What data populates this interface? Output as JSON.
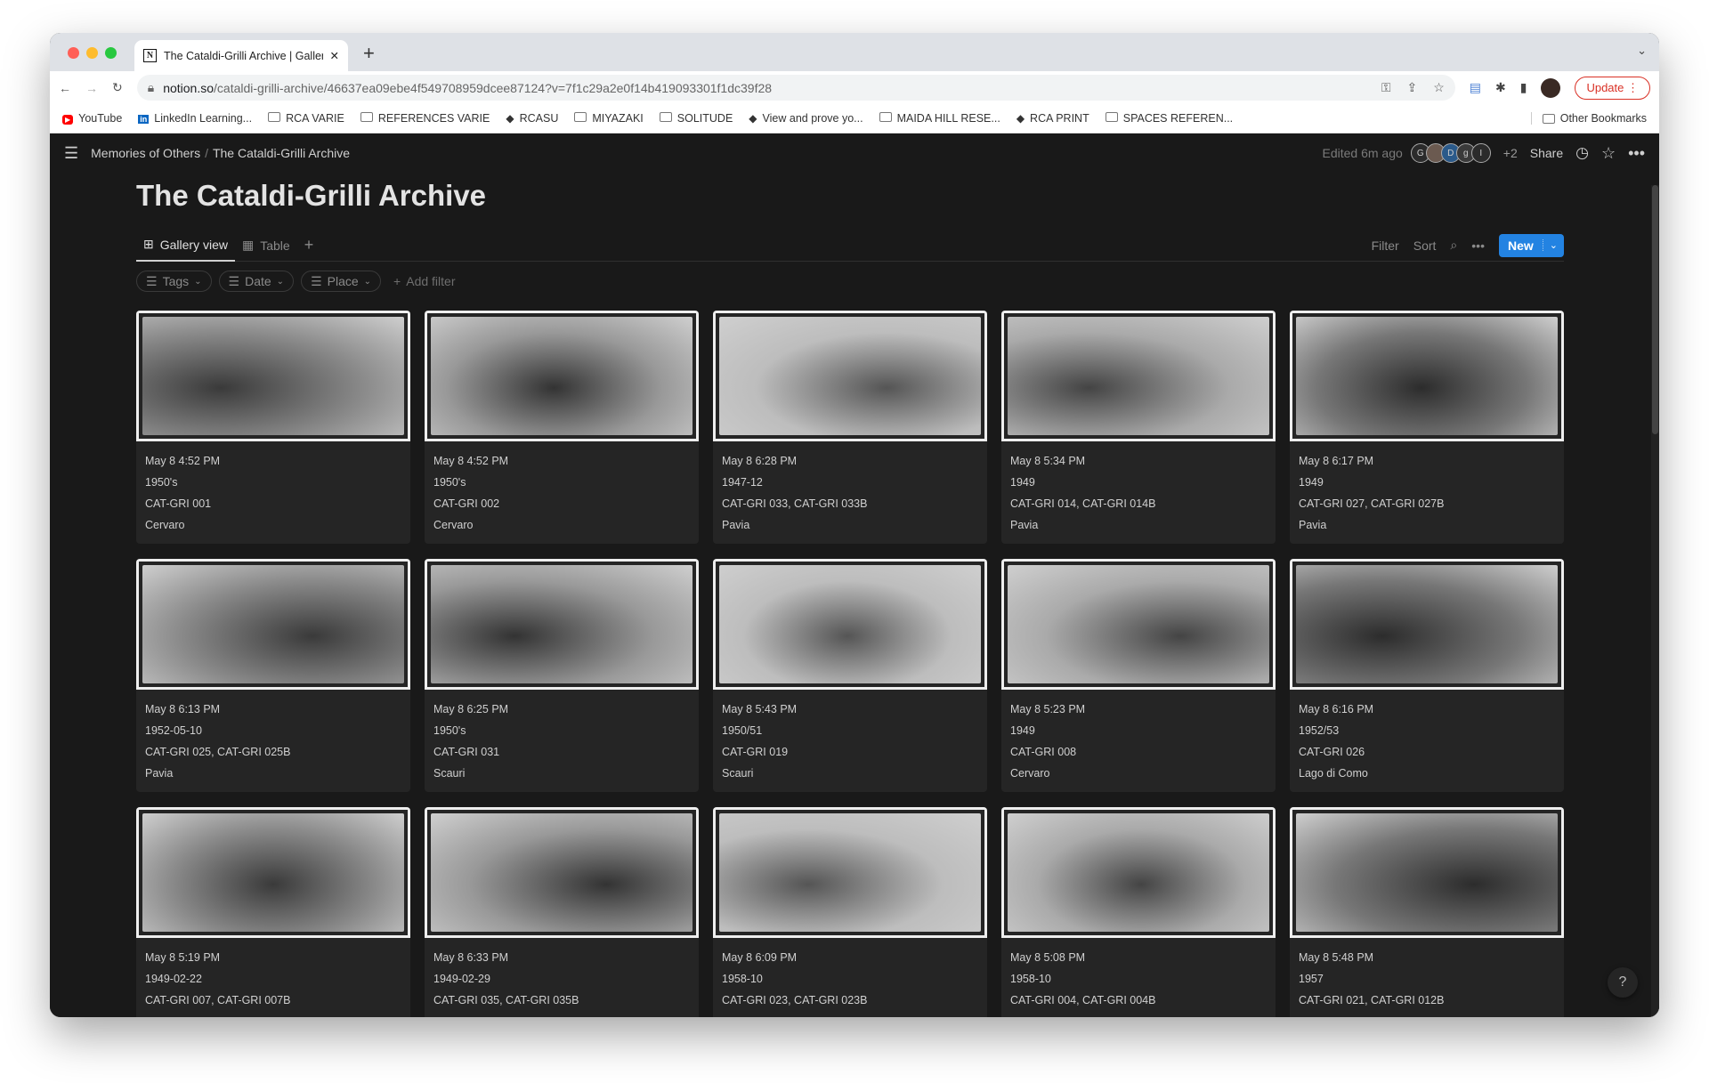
{
  "browser": {
    "tab_title": "The Cataldi-Grilli Archive | Gallery view",
    "url_domain": "notion.so",
    "url_path": "/cataldi-grilli-archive/46637ea09ebe4f549708959dcee87124?v=7f1c29a2e0f14b419093301f1dc39f28",
    "update_label": "Update",
    "bookmarks": [
      {
        "label": "YouTube",
        "icon": "youtube-icon"
      },
      {
        "label": "LinkedIn Learning...",
        "icon": "linkedin-icon"
      },
      {
        "label": "RCA VARIE",
        "icon": "folder-icon"
      },
      {
        "label": "REFERENCES VARIE",
        "icon": "folder-icon"
      },
      {
        "label": "RCASU",
        "icon": "site-icon"
      },
      {
        "label": "MIYAZAKI",
        "icon": "folder-icon"
      },
      {
        "label": "SOLITUDE",
        "icon": "folder-icon"
      },
      {
        "label": "View and prove yo...",
        "icon": "site-icon"
      },
      {
        "label": "MAIDA HILL RESE...",
        "icon": "folder-icon"
      },
      {
        "label": "RCA PRINT",
        "icon": "site-icon"
      },
      {
        "label": "SPACES REFEREN...",
        "icon": "folder-icon"
      }
    ],
    "other_bookmarks": "Other Bookmarks"
  },
  "topbar": {
    "breadcrumb": [
      "Memories of Others",
      "The Cataldi-Grilli Archive"
    ],
    "edited": "Edited 6m ago",
    "faces": [
      "G",
      "",
      "D",
      "g",
      "I"
    ],
    "more_count": "+2",
    "share": "Share"
  },
  "page": {
    "title": "The Cataldi-Grilli Archive",
    "views": [
      {
        "label": "Gallery view",
        "active": true
      },
      {
        "label": "Table",
        "active": false
      }
    ],
    "toolbar": {
      "filter": "Filter",
      "sort": "Sort",
      "new": "New"
    },
    "filters": [
      "Tags",
      "Date",
      "Place"
    ],
    "add_filter": "Add filter"
  },
  "colors": {
    "accent": "#2383e2",
    "background": "#191919",
    "card": "#252525"
  },
  "cards": [
    {
      "created": "May 8 4:52 PM",
      "date": "1950's",
      "code": "CAT-GRI 001",
      "place": "Cervaro"
    },
    {
      "created": "May 8 4:52 PM",
      "date": "1950's",
      "code": "CAT-GRI 002",
      "place": "Cervaro"
    },
    {
      "created": "May 8 6:28 PM",
      "date": "1947-12",
      "code": "CAT-GRI 033, CAT-GRI 033B",
      "place": "Pavia"
    },
    {
      "created": "May 8 5:34 PM",
      "date": "1949",
      "code": "CAT-GRI 014, CAT-GRI 014B",
      "place": "Pavia"
    },
    {
      "created": "May 8 6:17 PM",
      "date": "1949",
      "code": "CAT-GRI 027, CAT-GRI 027B",
      "place": "Pavia"
    },
    {
      "created": "May 8 6:13 PM",
      "date": "1952-05-10",
      "code": "CAT-GRI 025, CAT-GRI 025B",
      "place": "Pavia"
    },
    {
      "created": "May 8 6:25 PM",
      "date": "1950's",
      "code": "CAT-GRI 031",
      "place": "Scauri"
    },
    {
      "created": "May 8 5:43 PM",
      "date": "1950/51",
      "code": "CAT-GRI 019",
      "place": "Scauri"
    },
    {
      "created": "May 8 5:23 PM",
      "date": "1949",
      "code": "CAT-GRI 008",
      "place": "Cervaro"
    },
    {
      "created": "May 8 6:16 PM",
      "date": "1952/53",
      "code": "CAT-GRI 026",
      "place": "Lago di Como"
    },
    {
      "created": "May 8 5:19 PM",
      "date": "1949-02-22",
      "code": "CAT-GRI 007, CAT-GRI 007B"
    },
    {
      "created": "May 8 6:33 PM",
      "date": "1949-02-29",
      "code": "CAT-GRI 035, CAT-GRI 035B"
    },
    {
      "created": "May 8 6:09 PM",
      "date": "1958-10",
      "code": "CAT-GRI 023, CAT-GRI 023B"
    },
    {
      "created": "May 8 5:08 PM",
      "date": "1958-10",
      "code": "CAT-GRI 004, CAT-GRI 004B"
    },
    {
      "created": "May 8 5:48 PM",
      "date": "1957",
      "code": "CAT-GRI 021, CAT-GRI 012B"
    }
  ]
}
